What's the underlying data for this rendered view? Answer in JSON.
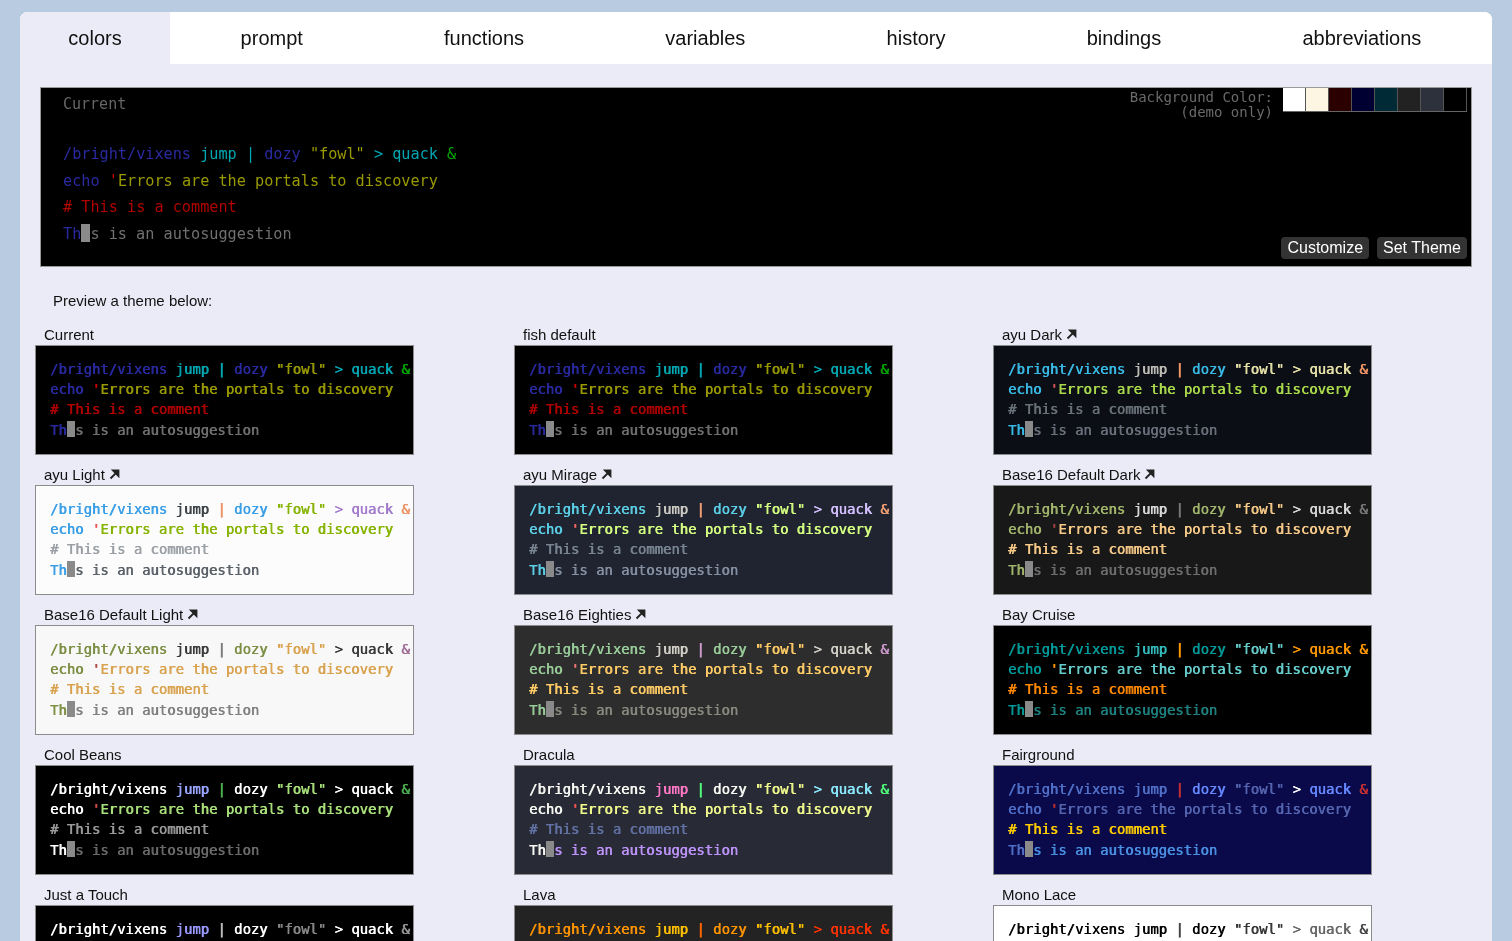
{
  "tabs": [
    {
      "label": "colors",
      "selected": true
    },
    {
      "label": "prompt",
      "selected": false
    },
    {
      "label": "functions",
      "selected": false
    },
    {
      "label": "variables",
      "selected": false
    },
    {
      "label": "history",
      "selected": false
    },
    {
      "label": "bindings",
      "selected": false
    },
    {
      "label": "abbreviations",
      "selected": false
    }
  ],
  "editor": {
    "title": "Current",
    "background_label": "Background Color:",
    "background_note": "(demo only)",
    "color": "#000000",
    "swatches": [
      {
        "color": "#ffffff"
      },
      {
        "color": "#fdf6e3"
      },
      {
        "color": "#2b0000"
      },
      {
        "color": "#000033"
      },
      {
        "color": "#002b36"
      },
      {
        "color": "#222222"
      },
      {
        "color": "#2c313c"
      },
      {
        "color": "#000000"
      }
    ],
    "lines": [
      [
        {
          "text": "/bright/vixens",
          "color": "#2a2aa0"
        },
        {
          "text": " jump",
          "color": "#00a6b2"
        },
        {
          "text": " |",
          "color": "#00a6b2"
        },
        {
          "text": " dozy",
          "color": "#2a2aa0"
        },
        {
          "text": " \"fowl\"",
          "color": "#999900"
        },
        {
          "text": " >",
          "color": "#00a6b2"
        },
        {
          "text": " quack",
          "color": "#00a6b2"
        },
        {
          "text": " &",
          "color": "#00a600"
        }
      ],
      [
        {
          "text": "echo",
          "color": "#2a2aa0"
        },
        {
          "text": " '",
          "color": "#cc0000"
        },
        {
          "text": "Errors are the portals to discovery",
          "color": "#999900"
        }
      ],
      [
        {
          "text": "# This is a comment",
          "color": "#b00000"
        }
      ],
      [
        {
          "text": "Th",
          "color": "#2a2aa0"
        },
        {
          "text": "s is an autosuggestion",
          "color": "#707070"
        }
      ]
    ],
    "buttons": [
      "Customize",
      "Set Theme"
    ]
  },
  "preview_heading": "Preview a theme below:",
  "themes": [
    {
      "name": "Current",
      "link": false,
      "color": "#000000",
      "lines": [
        [
          {
            "text": "/bright/vixens",
            "color": "#2a2aa0"
          },
          {
            "text": " jump",
            "color": "#00a6b2"
          },
          {
            "text": " |",
            "color": "#00a6b2"
          },
          {
            "text": " dozy",
            "color": "#2a2aa0"
          },
          {
            "text": " \"fowl\"",
            "color": "#999900"
          },
          {
            "text": " >",
            "color": "#00a6b2"
          },
          {
            "text": " quack",
            "color": "#00a6b2"
          },
          {
            "text": " &",
            "color": "#00a600"
          }
        ],
        [
          {
            "text": "echo",
            "color": "#2a2aa0"
          },
          {
            "text": " '",
            "color": "#cc0000"
          },
          {
            "text": "Errors are the portals to discovery",
            "color": "#999900"
          }
        ],
        [
          {
            "text": "# This is a comment",
            "color": "#b00000"
          }
        ],
        [
          {
            "text": "Th",
            "color": "#2a2aa0"
          },
          {
            "text": "s is an autosuggestion",
            "color": "#707070"
          }
        ]
      ]
    },
    {
      "name": "fish default",
      "link": false,
      "color": "#000000",
      "lines": [
        [
          {
            "text": "/bright/vixens",
            "color": "#2a2aa0"
          },
          {
            "text": " jump",
            "color": "#00a6b2"
          },
          {
            "text": " |",
            "color": "#00a6b2"
          },
          {
            "text": " dozy",
            "color": "#2a2aa0"
          },
          {
            "text": " \"fowl\"",
            "color": "#999900"
          },
          {
            "text": " >",
            "color": "#00a6b2"
          },
          {
            "text": " quack",
            "color": "#00a6b2"
          },
          {
            "text": " &",
            "color": "#00a600"
          }
        ],
        [
          {
            "text": "echo",
            "color": "#2a2aa0"
          },
          {
            "text": " '",
            "color": "#cc0000"
          },
          {
            "text": "Errors are the portals to discovery",
            "color": "#999900"
          }
        ],
        [
          {
            "text": "# This is a comment",
            "color": "#b00000"
          }
        ],
        [
          {
            "text": "Th",
            "color": "#2a2aa0"
          },
          {
            "text": "s is an autosuggestion",
            "color": "#707070"
          }
        ]
      ]
    },
    {
      "name": "ayu Dark",
      "link": true,
      "color": "#0b0e14",
      "lines": [
        [
          {
            "text": "/bright/vixens",
            "color": "#39bae6"
          },
          {
            "text": " jump",
            "color": "#bfbdb6"
          },
          {
            "text": " |",
            "color": "#f29668"
          },
          {
            "text": " dozy",
            "color": "#39bae6"
          },
          {
            "text": " \"fowl\"",
            "color": "#e6e1a8"
          },
          {
            "text": " >",
            "color": "#e6e1a8"
          },
          {
            "text": " quack",
            "color": "#e6e1a8"
          },
          {
            "text": " &",
            "color": "#f29668"
          }
        ],
        [
          {
            "text": "echo",
            "color": "#39bae6"
          },
          {
            "text": " '",
            "color": "#d95757"
          },
          {
            "text": "Errors are the portals to discovery",
            "color": "#aad94c"
          }
        ],
        [
          {
            "text": "# This is a comment",
            "color": "#6a727b"
          }
        ],
        [
          {
            "text": "Th",
            "color": "#39bae6"
          },
          {
            "text": "s is an autosuggestion",
            "color": "#6a707b"
          }
        ]
      ]
    },
    {
      "name": "ayu Light",
      "link": true,
      "color": "#fcfcfc",
      "lines": [
        [
          {
            "text": "/bright/vixens",
            "color": "#399ee6"
          },
          {
            "text": " jump",
            "color": "#3c4146"
          },
          {
            "text": " |",
            "color": "#ed9366"
          },
          {
            "text": " dozy",
            "color": "#399ee6"
          },
          {
            "text": " \"fowl\"",
            "color": "#86b300"
          },
          {
            "text": " >",
            "color": "#a37acc"
          },
          {
            "text": " quack",
            "color": "#a37acc"
          },
          {
            "text": " &",
            "color": "#ed9366"
          }
        ],
        [
          {
            "text": "echo",
            "color": "#399ee6"
          },
          {
            "text": " '",
            "color": "#e65050"
          },
          {
            "text": "Errors are the portals to discovery",
            "color": "#86b300"
          }
        ],
        [
          {
            "text": "# This is a comment",
            "color": "#9a9fa5"
          }
        ],
        [
          {
            "text": "Th",
            "color": "#399ee6"
          },
          {
            "text": "s is an autosuggestion",
            "color": "#5a6169"
          }
        ]
      ]
    },
    {
      "name": "ayu Mirage",
      "link": true,
      "color": "#1f2430",
      "lines": [
        [
          {
            "text": "/bright/vixens",
            "color": "#5ccfe6"
          },
          {
            "text": " jump",
            "color": "#cccac2"
          },
          {
            "text": " |",
            "color": "#f29e74"
          },
          {
            "text": " dozy",
            "color": "#5ccfe6"
          },
          {
            "text": " \"fowl\"",
            "color": "#d5ff80"
          },
          {
            "text": " >",
            "color": "#d4bfff"
          },
          {
            "text": " quack",
            "color": "#d4bfff"
          },
          {
            "text": " &",
            "color": "#f29e74"
          }
        ],
        [
          {
            "text": "echo",
            "color": "#5ccfe6"
          },
          {
            "text": " '",
            "color": "#ff6666"
          },
          {
            "text": "Errors are the portals to discovery",
            "color": "#d5ff80"
          }
        ],
        [
          {
            "text": "# This is a comment",
            "color": "#7a8592"
          }
        ],
        [
          {
            "text": "Th",
            "color": "#5ccfe6"
          },
          {
            "text": "s is an autosuggestion",
            "color": "#8590a2"
          }
        ]
      ]
    },
    {
      "name": "Base16 Default Dark",
      "link": true,
      "color": "#181818",
      "lines": [
        [
          {
            "text": "/bright/vixens",
            "color": "#a1b56c"
          },
          {
            "text": " jump",
            "color": "#d8d8d8"
          },
          {
            "text": " |",
            "color": "#787878"
          },
          {
            "text": " dozy",
            "color": "#a1b56c"
          },
          {
            "text": " \"fowl\"",
            "color": "#f7ca88"
          },
          {
            "text": " >",
            "color": "#d8d8d8"
          },
          {
            "text": " quack",
            "color": "#d8d8d8"
          },
          {
            "text": " &",
            "color": "#787878"
          }
        ],
        [
          {
            "text": "echo",
            "color": "#a1b56c"
          },
          {
            "text": " '",
            "color": "#ab4642"
          },
          {
            "text": "Errors are the portals to discovery",
            "color": "#f7ca88"
          }
        ],
        [
          {
            "text": "# This is a comment",
            "color": "#f7ca88"
          }
        ],
        [
          {
            "text": "Th",
            "color": "#a1b56c"
          },
          {
            "text": "s is an autosuggestion",
            "color": "#6e6e6e"
          }
        ]
      ]
    },
    {
      "name": "Base16 Default Light",
      "link": true,
      "color": "#f8f8f8",
      "lines": [
        [
          {
            "text": "/bright/vixens",
            "color": "#7c8f44"
          },
          {
            "text": " jump",
            "color": "#383838"
          },
          {
            "text": " |",
            "color": "#7a7a7a"
          },
          {
            "text": " dozy",
            "color": "#7c8f44"
          },
          {
            "text": " \"fowl\"",
            "color": "#d9a24f"
          },
          {
            "text": " >",
            "color": "#383838"
          },
          {
            "text": " quack",
            "color": "#383838"
          },
          {
            "text": " &",
            "color": "#a06e96"
          }
        ],
        [
          {
            "text": "echo",
            "color": "#7c8f44"
          },
          {
            "text": " '",
            "color": "#ab4642"
          },
          {
            "text": "Errors are the portals to discovery",
            "color": "#d9a24f"
          }
        ],
        [
          {
            "text": "# This is a comment",
            "color": "#d9a24f"
          }
        ],
        [
          {
            "text": "Th",
            "color": "#7c8f44"
          },
          {
            "text": "s is an autosuggestion",
            "color": "#7f7f7f"
          }
        ]
      ]
    },
    {
      "name": "Base16 Eighties",
      "link": true,
      "color": "#2d2d2d",
      "lines": [
        [
          {
            "text": "/bright/vixens",
            "color": "#99cc99"
          },
          {
            "text": " jump",
            "color": "#d3d0c8"
          },
          {
            "text": " |",
            "color": "#cc99cc"
          },
          {
            "text": " dozy",
            "color": "#99cc99"
          },
          {
            "text": " \"fowl\"",
            "color": "#ffcc66"
          },
          {
            "text": " >",
            "color": "#d3d0c8"
          },
          {
            "text": " quack",
            "color": "#d3d0c8"
          },
          {
            "text": " &",
            "color": "#cc99cc"
          }
        ],
        [
          {
            "text": "echo",
            "color": "#99cc99"
          },
          {
            "text": " '",
            "color": "#f2777a"
          },
          {
            "text": "Errors are the portals to discovery",
            "color": "#ffcc66"
          }
        ],
        [
          {
            "text": "# This is a comment",
            "color": "#ffcc66"
          }
        ],
        [
          {
            "text": "Th",
            "color": "#99cc99"
          },
          {
            "text": "s is an autosuggestion",
            "color": "#8a897f"
          }
        ]
      ]
    },
    {
      "name": "Bay Cruise",
      "link": false,
      "color": "#000000",
      "lines": [
        [
          {
            "text": "/bright/vixens",
            "color": "#009999"
          },
          {
            "text": " jump",
            "color": "#33bbbb"
          },
          {
            "text": " |",
            "color": "#ff9900"
          },
          {
            "text": " dozy",
            "color": "#009999"
          },
          {
            "text": " \"fowl\"",
            "color": "#66cccc"
          },
          {
            "text": " >",
            "color": "#ff9900"
          },
          {
            "text": " quack",
            "color": "#ff9900"
          },
          {
            "text": " &",
            "color": "#ff9900"
          }
        ],
        [
          {
            "text": "echo",
            "color": "#009999"
          },
          {
            "text": " '",
            "color": "#ff9900"
          },
          {
            "text": "Errors are the portals to discovery",
            "color": "#66cccc"
          }
        ],
        [
          {
            "text": "# This is a comment",
            "color": "#ff8800"
          }
        ],
        [
          {
            "text": "Th",
            "color": "#009999"
          },
          {
            "text": "s is an autosuggestion",
            "color": "#1f8080"
          }
        ]
      ]
    },
    {
      "name": "Cool Beans",
      "link": false,
      "color": "#000000",
      "lines": [
        [
          {
            "text": "/bright/vixens",
            "color": "#ffffff"
          },
          {
            "text": " jump",
            "color": "#9aa6ff"
          },
          {
            "text": " |",
            "color": "#4caf50"
          },
          {
            "text": " dozy",
            "color": "#ffffff"
          },
          {
            "text": " \"fowl\"",
            "color": "#a8e07a"
          },
          {
            "text": " >",
            "color": "#ffffff"
          },
          {
            "text": " quack",
            "color": "#ffffff"
          },
          {
            "text": " &",
            "color": "#4caf50"
          }
        ],
        [
          {
            "text": "echo",
            "color": "#ffffff"
          },
          {
            "text": " '",
            "color": "#e05050"
          },
          {
            "text": "Errors are the portals to discovery",
            "color": "#a8e07a"
          }
        ],
        [
          {
            "text": "# This is a comment",
            "color": "#999999"
          }
        ],
        [
          {
            "text": "Th",
            "color": "#ffffff"
          },
          {
            "text": "s is an autosuggestion",
            "color": "#6a6a6a"
          }
        ]
      ]
    },
    {
      "name": "Dracula",
      "link": false,
      "color": "#282a36",
      "lines": [
        [
          {
            "text": "/bright/vixens",
            "color": "#f8f8f2"
          },
          {
            "text": " jump",
            "color": "#ff79c6"
          },
          {
            "text": " |",
            "color": "#50fa7b"
          },
          {
            "text": " dozy",
            "color": "#f8f8f2"
          },
          {
            "text": " \"fowl\"",
            "color": "#f1fa8c"
          },
          {
            "text": " >",
            "color": "#8be9fd"
          },
          {
            "text": " quack",
            "color": "#8be9fd"
          },
          {
            "text": " &",
            "color": "#50fa7b"
          }
        ],
        [
          {
            "text": "echo",
            "color": "#f8f8f2"
          },
          {
            "text": " '",
            "color": "#ff5555"
          },
          {
            "text": "Errors are the portals to discovery",
            "color": "#f1fa8c"
          }
        ],
        [
          {
            "text": "# This is a comment",
            "color": "#6272a4"
          }
        ],
        [
          {
            "text": "Th",
            "color": "#f8f8f2"
          },
          {
            "text": "s is an autosuggestion",
            "color": "#bd93f9"
          }
        ]
      ]
    },
    {
      "name": "Fairground",
      "link": false,
      "color": "#0a0a4a",
      "lines": [
        [
          {
            "text": "/bright/vixens",
            "color": "#5070c8"
          },
          {
            "text": " jump",
            "color": "#5070c8"
          },
          {
            "text": " |",
            "color": "#c83030"
          },
          {
            "text": " dozy",
            "color": "#6688ff"
          },
          {
            "text": " \"fowl\"",
            "color": "#5565b0"
          },
          {
            "text": " >",
            "color": "#ffffff"
          },
          {
            "text": " quack",
            "color": "#6688ff"
          },
          {
            "text": " &",
            "color": "#c83030"
          }
        ],
        [
          {
            "text": "echo",
            "color": "#5070c8"
          },
          {
            "text": " '",
            "color": "#c83030"
          },
          {
            "text": "Errors are the portals to discovery",
            "color": "#5565b0"
          }
        ],
        [
          {
            "text": "# This is a comment",
            "color": "#ffcc00"
          }
        ],
        [
          {
            "text": "Th",
            "color": "#5070c8"
          },
          {
            "text": "s is an autosuggestion",
            "color": "#4a90e2"
          }
        ]
      ]
    },
    {
      "name": "Just a Touch",
      "link": false,
      "color": "#000000",
      "lines": [
        [
          {
            "text": "/bright/vixens",
            "color": "#ffffff"
          },
          {
            "text": " jump",
            "color": "#9a9aff"
          },
          {
            "text": " |",
            "color": "#bbbbbb"
          },
          {
            "text": " dozy",
            "color": "#ffffff"
          },
          {
            "text": " \"fowl\"",
            "color": "#8a8a8a"
          },
          {
            "text": " >",
            "color": "#ffffff"
          },
          {
            "text": " quack",
            "color": "#ffffff"
          },
          {
            "text": " &",
            "color": "#999999"
          }
        ]
      ]
    },
    {
      "name": "Lava",
      "link": false,
      "color": "#232323",
      "lines": [
        [
          {
            "text": "/bright/vixens",
            "color": "#ff9400"
          },
          {
            "text": " jump",
            "color": "#ffc000"
          },
          {
            "text": " |",
            "color": "#ff6600"
          },
          {
            "text": " dozy",
            "color": "#ff9400"
          },
          {
            "text": " \"fowl\"",
            "color": "#ffc000"
          },
          {
            "text": " >",
            "color": "#ff3300"
          },
          {
            "text": " quack",
            "color": "#ff3300"
          },
          {
            "text": " &",
            "color": "#ff3300"
          }
        ]
      ]
    },
    {
      "name": "Mono Lace",
      "link": false,
      "color": "#ffffff",
      "lines": [
        [
          {
            "text": "/bright/vixens",
            "color": "#000000"
          },
          {
            "text": " jump",
            "color": "#000000"
          },
          {
            "text": " |",
            "color": "#444444"
          },
          {
            "text": " dozy",
            "color": "#000000"
          },
          {
            "text": " \"fowl\"",
            "color": "#333333"
          },
          {
            "text": " >",
            "color": "#666666"
          },
          {
            "text": " quack",
            "color": "#666666"
          },
          {
            "text": " &",
            "color": "#444444"
          }
        ]
      ]
    }
  ]
}
